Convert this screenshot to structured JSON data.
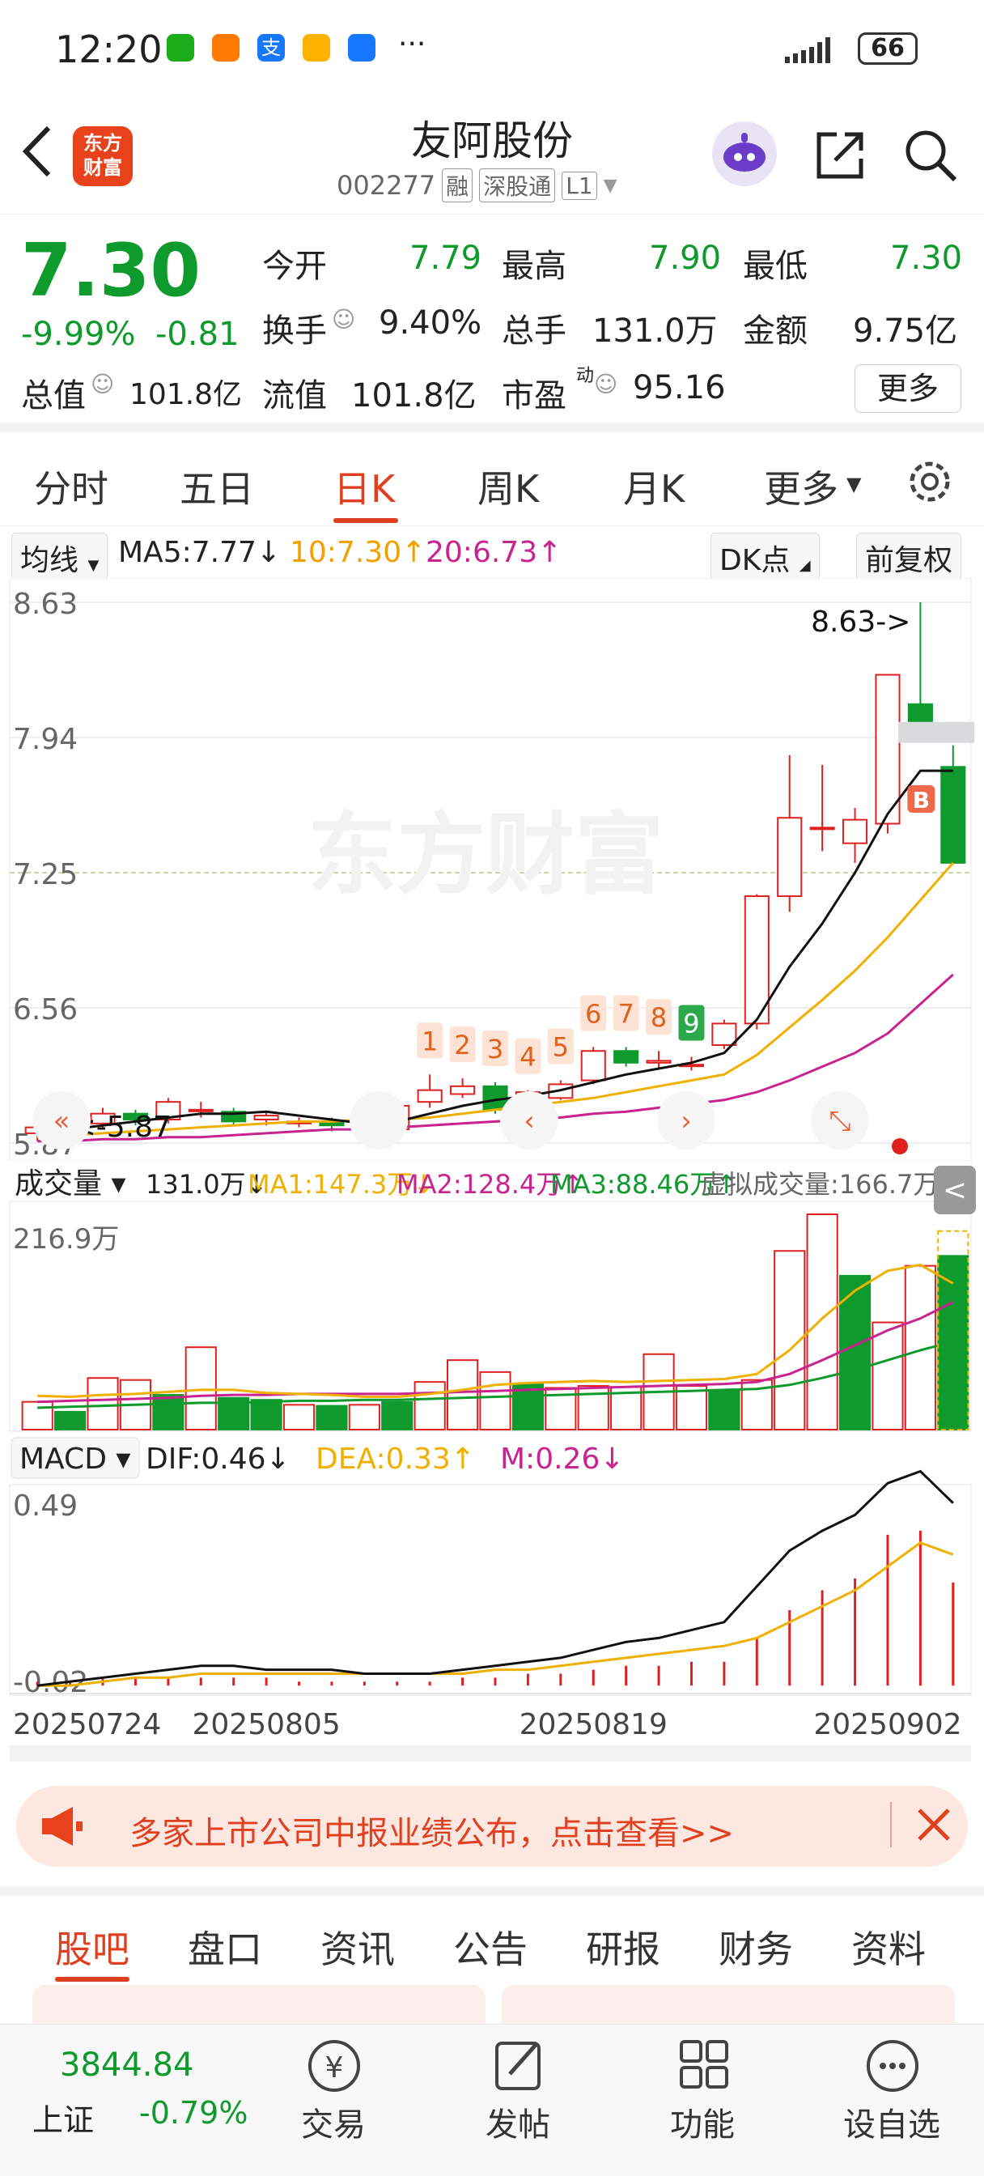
{
  "status": {
    "time": "12:20",
    "battery": "66",
    "more": "···"
  },
  "header": {
    "back_label": "<",
    "logo_text": "东方\n财富",
    "title": "友阿股份",
    "code": "002277",
    "badge_rong": "融",
    "badge_sgt": "深股通",
    "badge_level": "L1"
  },
  "quote": {
    "price": "7.30",
    "change_pct": "-9.99%",
    "change_abs": "-0.81",
    "open_label": "今开",
    "open": "7.79",
    "high_label": "最高",
    "high": "7.90",
    "low_label": "最低",
    "low": "7.30",
    "turnover_label": "换手",
    "turnover": "9.40%",
    "volume_label": "总手",
    "volume": "131.0万",
    "amount_label": "金额",
    "amount": "9.75亿",
    "mktcap_label": "总值",
    "mktcap": "101.8亿",
    "float_label": "流值",
    "float": "101.8亿",
    "pe_label": "市盈",
    "pe_sup": "动",
    "pe": "95.16",
    "more_button": "更多"
  },
  "tabs": [
    "分时",
    "五日",
    "日K",
    "周K",
    "月K",
    "更多",
    "⚙"
  ],
  "active_tab": "日K",
  "chart_header": {
    "ma_select": "均线",
    "ma5": "MA5:7.77↓",
    "ma10": "10:7.30↑",
    "ma20": "20:6.73↑",
    "dk_button": "DK点",
    "fq_button": "前复权"
  },
  "kline": {
    "y_labels": [
      "8.63",
      "7.94",
      "7.25",
      "6.56",
      "5.87"
    ],
    "max_annotation": "8.63->",
    "min_annotation": "<-5.87",
    "watermark": "东方财富",
    "count_labels": [
      "1",
      "2",
      "3",
      "4",
      "5",
      "6",
      "7",
      "8",
      "9"
    ],
    "b_marker": "B"
  },
  "volume": {
    "select": "成交量",
    "value": "131.0万↓",
    "ma1": "MA1:147.3万↓",
    "ma2": "MA2:128.4万↑",
    "ma3": "MA3:88.46万↑",
    "virtual": "虚拟成交量:166.7万",
    "y_max": "216.9万"
  },
  "macd": {
    "select": "MACD",
    "dif": "DIF:0.46↓",
    "dea": "DEA:0.33↑",
    "m": "M:0.26↓",
    "y_top": "0.49",
    "y_bottom": "-0.02",
    "dates": [
      "20250724",
      "20250805",
      "20250819",
      "20250902"
    ]
  },
  "banner": {
    "text": "多家上市公司中报业绩公布，点击查看>>"
  },
  "bottom_tabs": [
    "股吧",
    "盘口",
    "资讯",
    "公告",
    "研报",
    "财务",
    "资料"
  ],
  "bottom_active": "股吧",
  "footer": {
    "index_value": "3844.84",
    "index_name": "上证",
    "index_change": "-0.79%",
    "items": [
      "交易",
      "发帖",
      "功能",
      "设自选"
    ]
  },
  "colors": {
    "up": "#e02020",
    "down": "#0e9a2c",
    "ma10": "#f0b000",
    "ma20": "#c8238f",
    "accent": "#e04020"
  },
  "chart_data": [
    {
      "type": "candlestick",
      "title": "日K",
      "ylim": [
        5.87,
        8.63
      ],
      "candles": [
        {
          "o": 5.92,
          "c": 5.95,
          "h": 5.98,
          "l": 5.88
        },
        {
          "o": 5.9,
          "c": 5.96,
          "h": 6.0,
          "l": 5.87
        },
        {
          "o": 5.97,
          "c": 6.02,
          "h": 6.05,
          "l": 5.94
        },
        {
          "o": 6.02,
          "c": 5.99,
          "h": 6.04,
          "l": 5.96
        },
        {
          "o": 5.99,
          "c": 6.08,
          "h": 6.1,
          "l": 5.97
        },
        {
          "o": 6.04,
          "c": 6.04,
          "h": 6.08,
          "l": 6.0
        },
        {
          "o": 6.03,
          "c": 5.98,
          "h": 6.05,
          "l": 5.96
        },
        {
          "o": 5.99,
          "c": 6.01,
          "h": 6.03,
          "l": 5.96
        },
        {
          "o": 5.97,
          "c": 5.98,
          "h": 6.0,
          "l": 5.95
        },
        {
          "o": 5.98,
          "c": 5.96,
          "h": 6.0,
          "l": 5.93
        },
        {
          "o": 5.96,
          "c": 5.94,
          "h": 6.0,
          "l": 5.92
        },
        {
          "o": 5.94,
          "c": 6.06,
          "h": 6.08,
          "l": 5.93
        },
        {
          "o": 6.08,
          "c": 6.14,
          "h": 6.22,
          "l": 6.05
        },
        {
          "o": 6.12,
          "c": 6.16,
          "h": 6.2,
          "l": 6.1
        },
        {
          "o": 6.16,
          "c": 6.04,
          "h": 6.18,
          "l": 6.02
        },
        {
          "o": 6.03,
          "c": 6.13,
          "h": 6.14,
          "l": 6.02
        },
        {
          "o": 6.1,
          "c": 6.17,
          "h": 6.19,
          "l": 6.09
        },
        {
          "o": 6.19,
          "c": 6.34,
          "h": 6.36,
          "l": 6.17
        },
        {
          "o": 6.34,
          "c": 6.28,
          "h": 6.36,
          "l": 6.26
        },
        {
          "o": 6.28,
          "c": 6.29,
          "h": 6.34,
          "l": 6.25
        },
        {
          "o": 6.27,
          "c": 6.27,
          "h": 6.31,
          "l": 6.24
        },
        {
          "o": 6.37,
          "c": 6.48,
          "h": 6.5,
          "l": 6.35
        },
        {
          "o": 6.48,
          "c": 7.13,
          "h": 7.14,
          "l": 6.45
        },
        {
          "o": 7.13,
          "c": 7.53,
          "h": 7.85,
          "l": 7.05
        },
        {
          "o": 7.48,
          "c": 7.48,
          "h": 7.8,
          "l": 7.36
        },
        {
          "o": 7.4,
          "c": 7.52,
          "h": 7.58,
          "l": 7.3
        },
        {
          "o": 7.5,
          "c": 8.26,
          "h": 8.26,
          "l": 7.45
        },
        {
          "o": 8.11,
          "c": 7.97,
          "h": 8.63,
          "l": 7.95
        },
        {
          "o": 7.79,
          "c": 7.3,
          "h": 7.9,
          "l": 7.3
        }
      ],
      "ma5": [
        5.93,
        5.94,
        5.96,
        5.98,
        6.0,
        6.02,
        6.02,
        6.03,
        6.01,
        5.99,
        5.97,
        5.98,
        6.02,
        6.06,
        6.09,
        6.11,
        6.14,
        6.18,
        6.22,
        6.25,
        6.28,
        6.33,
        6.5,
        6.77,
        6.99,
        7.25,
        7.55,
        7.77,
        7.77
      ],
      "ma10": [
        5.9,
        5.91,
        5.92,
        5.93,
        5.94,
        5.95,
        5.96,
        5.97,
        5.98,
        5.98,
        5.99,
        5.99,
        6.0,
        6.02,
        6.04,
        6.06,
        6.08,
        6.1,
        6.13,
        6.16,
        6.19,
        6.22,
        6.32,
        6.46,
        6.6,
        6.75,
        6.92,
        7.11,
        7.3
      ],
      "ma20": [
        5.88,
        5.88,
        5.89,
        5.89,
        5.9,
        5.9,
        5.91,
        5.92,
        5.93,
        5.94,
        5.94,
        5.95,
        5.96,
        5.97,
        5.98,
        5.99,
        6.0,
        6.02,
        6.03,
        6.05,
        6.07,
        6.09,
        6.13,
        6.19,
        6.26,
        6.33,
        6.43,
        6.58,
        6.73
      ]
    },
    {
      "type": "bar",
      "title": "成交量",
      "ymax": 216.9,
      "values": [
        28,
        18,
        52,
        50,
        35,
        83,
        32,
        30,
        25,
        24,
        25,
        28,
        48,
        70,
        58,
        46,
        42,
        44,
        43,
        76,
        44,
        40,
        50,
        180,
        216.9,
        155,
        108,
        165,
        175
      ],
      "up": [
        true,
        false,
        true,
        true,
        false,
        true,
        false,
        false,
        true,
        false,
        true,
        false,
        true,
        true,
        true,
        false,
        true,
        true,
        true,
        true,
        true,
        false,
        true,
        true,
        true,
        false,
        true,
        true,
        false
      ],
      "ma1": [
        34,
        33,
        35,
        36,
        38,
        40,
        40,
        37,
        36,
        35,
        33,
        33,
        36,
        40,
        45,
        47,
        48,
        49,
        48,
        49,
        50,
        51,
        56,
        80,
        112,
        140,
        160,
        166,
        147.3
      ],
      "ma2": [
        28,
        29,
        30,
        31,
        32,
        34,
        35,
        35,
        36,
        36,
        36,
        36,
        37,
        38,
        39,
        40,
        41,
        42,
        43,
        44,
        45,
        46,
        48,
        56,
        70,
        85,
        100,
        112,
        128.4
      ],
      "ma3": [
        22,
        23,
        24,
        25,
        26,
        27,
        27,
        28,
        29,
        29,
        30,
        30,
        31,
        32,
        33,
        34,
        35,
        36,
        37,
        38,
        39,
        40,
        41,
        45,
        52,
        60,
        70,
        80,
        88.46
      ]
    },
    {
      "type": "bar",
      "title": "MACD",
      "ylim": [
        -0.02,
        0.49
      ],
      "m": [
        0.01,
        0.01,
        0.02,
        0.02,
        0.02,
        0.02,
        0.02,
        0.02,
        0.01,
        0.01,
        0.01,
        0.01,
        0.01,
        0.02,
        0.02,
        0.03,
        0.03,
        0.04,
        0.05,
        0.05,
        0.06,
        0.06,
        0.12,
        0.19,
        0.24,
        0.27,
        0.38,
        0.39,
        0.26
      ],
      "dif": [
        0.0,
        0.01,
        0.02,
        0.03,
        0.04,
        0.05,
        0.05,
        0.04,
        0.04,
        0.04,
        0.03,
        0.03,
        0.03,
        0.04,
        0.05,
        0.06,
        0.07,
        0.09,
        0.11,
        0.12,
        0.14,
        0.16,
        0.25,
        0.34,
        0.39,
        0.43,
        0.51,
        0.54,
        0.46
      ],
      "dea": [
        0.0,
        0.0,
        0.01,
        0.02,
        0.02,
        0.03,
        0.03,
        0.03,
        0.03,
        0.03,
        0.03,
        0.03,
        0.03,
        0.03,
        0.04,
        0.04,
        0.05,
        0.06,
        0.07,
        0.08,
        0.09,
        0.1,
        0.12,
        0.16,
        0.2,
        0.24,
        0.3,
        0.36,
        0.33
      ]
    }
  ]
}
